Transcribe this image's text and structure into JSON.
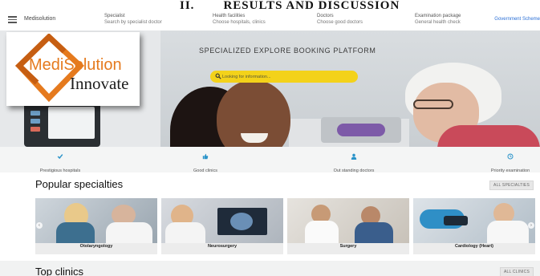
{
  "paper": {
    "section_number": "II.",
    "section_title": "RESULTS AND DISCUSSION"
  },
  "nav": {
    "brand": "Medisolution",
    "items": [
      {
        "title": "Specialist",
        "subtitle": "Search by specialist doctor"
      },
      {
        "title": "Health facilities",
        "subtitle": "Choose hospitals, clinics"
      },
      {
        "title": "Doctors",
        "subtitle": "Choose good doctors"
      },
      {
        "title": "Examination package",
        "subtitle": "General health check"
      }
    ],
    "gov_link": "Government Scheme"
  },
  "hero": {
    "title": "SPECIALIZED EXPLORE BOOKING PLATFORM",
    "search_placeholder": "Looking for information..."
  },
  "logo": {
    "name": "MediSolution",
    "tagline": "Innovate"
  },
  "features": [
    {
      "label": "Prestigious hospitals",
      "icon": "check-icon"
    },
    {
      "label": "Good clinics",
      "icon": "thumbs-up-icon"
    },
    {
      "label": "Out standing doctors",
      "icon": "doctor-icon"
    },
    {
      "label": "Priority examination",
      "icon": "clock-icon"
    }
  ],
  "specialties": {
    "title": "Popular specialties",
    "all_button": "ALL SPECIALTIES",
    "items": [
      {
        "label": "Otolaryngology"
      },
      {
        "label": "Neurosurgery"
      },
      {
        "label": "Surgery"
      },
      {
        "label": "Cardiology (Heart)"
      }
    ]
  },
  "clinics": {
    "title": "Top clinics",
    "all_button": "ALL CLINICS"
  },
  "colors": {
    "accent_yellow": "#f3d21a",
    "logo_orange": "#e57a1e",
    "link_blue": "#2a6fd6"
  }
}
